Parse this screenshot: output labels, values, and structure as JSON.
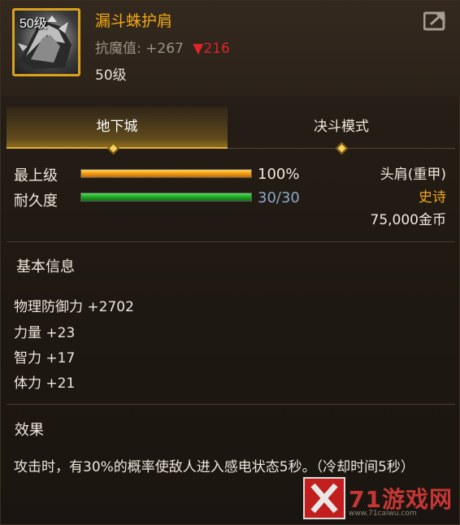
{
  "item": {
    "level_badge": "50级",
    "name": "漏斗蛛护肩",
    "resist_label": "抗魔值:",
    "resist_value": "+267",
    "resist_down_arrow": "▼",
    "resist_down_value": "216",
    "required_level": "50级"
  },
  "tabs": [
    {
      "label": "地下城",
      "active": true
    },
    {
      "label": "决斗模式",
      "active": false
    }
  ],
  "stats": {
    "max_level_label": "最上级",
    "max_level_value": "100%",
    "max_level_fill": 1.0,
    "durability_label": "耐久度",
    "durability_value": "30/30",
    "durability_fill": 1.0
  },
  "equipment": {
    "slot": "头肩(重甲)",
    "rarity": "史诗",
    "price": "75,000金币"
  },
  "basic_info": {
    "title": "基本信息",
    "attributes": [
      "物理防御力 +2702",
      "力量 +23",
      "智力 +17",
      "体力 +21"
    ]
  },
  "effect": {
    "title": "效果",
    "text": "攻击时，有30%的概率使敌人进入感电状态5秒。（冷却时间5秒）"
  },
  "watermark": {
    "text": "71游戏网",
    "sub": "www.71caiwu.com"
  },
  "colors": {
    "item_name": "#f1a714",
    "rarity": "#f1a714",
    "resist_down": "#e0242a",
    "durability_value": "#8ba7c9",
    "tab_active_underline": "#e0b23a"
  },
  "icons": {
    "share": "share-icon",
    "item": "shoulder-armor-icon"
  }
}
